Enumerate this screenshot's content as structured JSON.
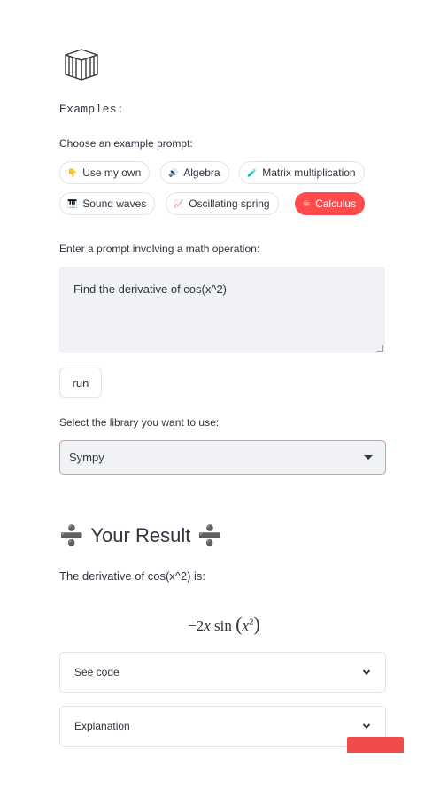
{
  "examples": {
    "heading": "Examples:",
    "choose_label": "Choose an example prompt:",
    "pills": [
      {
        "icon": "👇",
        "label": "Use my own"
      },
      {
        "icon": "🔊",
        "label": "Algebra"
      },
      {
        "icon": "🧪",
        "label": "Matrix multiplication"
      },
      {
        "icon": "🎹",
        "label": "Sound waves"
      },
      {
        "icon": "📈",
        "label": "Oscillating spring"
      },
      {
        "icon": "♾",
        "label": "Calculus"
      }
    ],
    "selected": "Calculus"
  },
  "prompt": {
    "label": "Enter a prompt involving a math operation:",
    "value": "Find the derivative of cos(x^2)"
  },
  "run_button": {
    "label": "run"
  },
  "library": {
    "label": "Select the library you want to use:",
    "selected": "Sympy"
  },
  "result": {
    "title": "Your Result",
    "description": "The derivative of cos(x^2) is:",
    "formula": {
      "lead": "−2",
      "x": "x",
      "fn": "sin",
      "exp": "2"
    }
  },
  "expanders": [
    {
      "label": "See code"
    },
    {
      "label": "Explanation"
    }
  ],
  "colors": {
    "accent": "#ff4b4b",
    "input_bg": "#f0f2f6",
    "text": "#31333f"
  }
}
